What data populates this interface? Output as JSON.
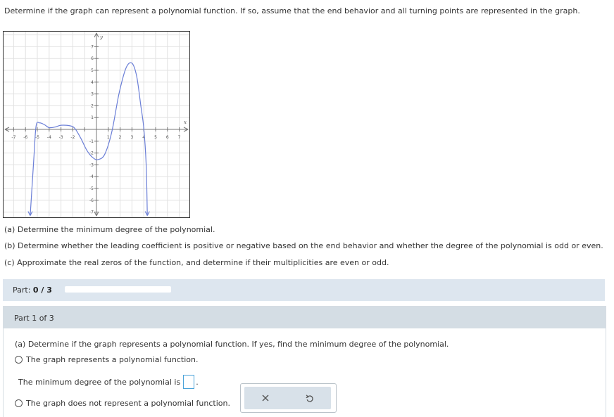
{
  "question": {
    "text": "Determine if the graph can represent a polynomial function. If so, assume that the end behavior and all turning points are represented in the graph."
  },
  "graph": {
    "x_axis_label": "x",
    "y_axis_label": "y",
    "x_tick_labels": [
      "-7",
      "-6",
      "-5",
      "-4",
      "-3",
      "-2",
      "1",
      "2",
      "3",
      "4",
      "5",
      "6",
      "7"
    ],
    "y_tick_labels": [
      "7",
      "6",
      "5",
      "4",
      "3",
      "2",
      "1",
      "-1",
      "-2",
      "-3",
      "-4",
      "-5",
      "-6",
      "-7"
    ],
    "curve_color": "#6b7fd7",
    "grid_color": "#e2e2e2",
    "axis_color": "#777777"
  },
  "tasks": [
    "(a) Determine the minimum degree of the polynomial.",
    "(b) Determine whether the leading coefficient is positive or negative based on the end behavior and whether the degree of the polynomial is odd or even.",
    "(c) Approximate the real zeros of the function, and determine if their multiplicities are even or odd."
  ],
  "progress": {
    "label": "Part:",
    "value": "0 / 3",
    "fraction": 0
  },
  "part": {
    "header": "Part 1 of 3",
    "question": "(a) Determine if the graph represents a polynomial function. If yes, find the minimum degree of the polynomial.",
    "option_yes": "The graph represents a polynomial function.",
    "degree_label": "The minimum degree of the polynomial is",
    "degree_value": "",
    "degree_period": ".",
    "option_no": "The graph does not represent a polynomial function."
  },
  "tools": {
    "clear_icon": "x-icon",
    "undo_icon": "undo-icon"
  }
}
